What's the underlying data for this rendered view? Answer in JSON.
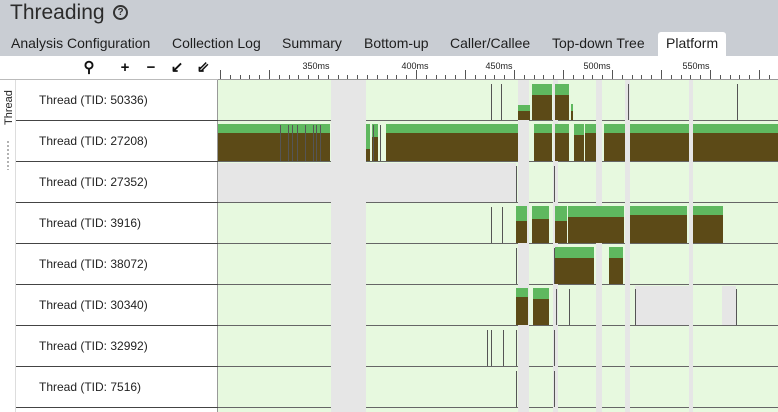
{
  "app": {
    "title": "Threading",
    "help_icon": "?"
  },
  "tabs": [
    {
      "label": "Analysis Configuration",
      "active": false
    },
    {
      "label": "Collection Log",
      "active": false
    },
    {
      "label": "Summary",
      "active": false
    },
    {
      "label": "Bottom-up",
      "active": false
    },
    {
      "label": "Caller/Callee",
      "active": false
    },
    {
      "label": "Top-down Tree",
      "active": false
    },
    {
      "label": "Platform",
      "active": true
    }
  ],
  "toolbar": [
    {
      "name": "zoom-search-icon",
      "glyph": "⚲"
    },
    {
      "name": "zoom-in-icon",
      "glyph": "+"
    },
    {
      "name": "zoom-out-icon",
      "glyph": "−"
    },
    {
      "name": "zoom-back-icon",
      "glyph": "↙"
    },
    {
      "name": "zoom-reset-icon",
      "glyph": "⇙"
    }
  ],
  "ruler": {
    "ticks": [
      "350ms",
      "400ms",
      "450ms",
      "500ms",
      "550ms"
    ]
  },
  "side_label": "Thread",
  "threads": [
    "Thread (TID: 50336)",
    "Thread (TID: 27208)",
    "Thread (TID: 27352)",
    "Thread (TID: 3916)",
    "Thread (TID: 38072)",
    "Thread (TID: 30340)",
    "Thread (TID: 32992)",
    "Thread (TID: 7516)"
  ],
  "colors": {
    "idle": "#e7f9df",
    "running": "#5fb85f",
    "cpu": "#5c4a17",
    "gap": "#e6e6e6",
    "header": "#c9cdd3"
  }
}
